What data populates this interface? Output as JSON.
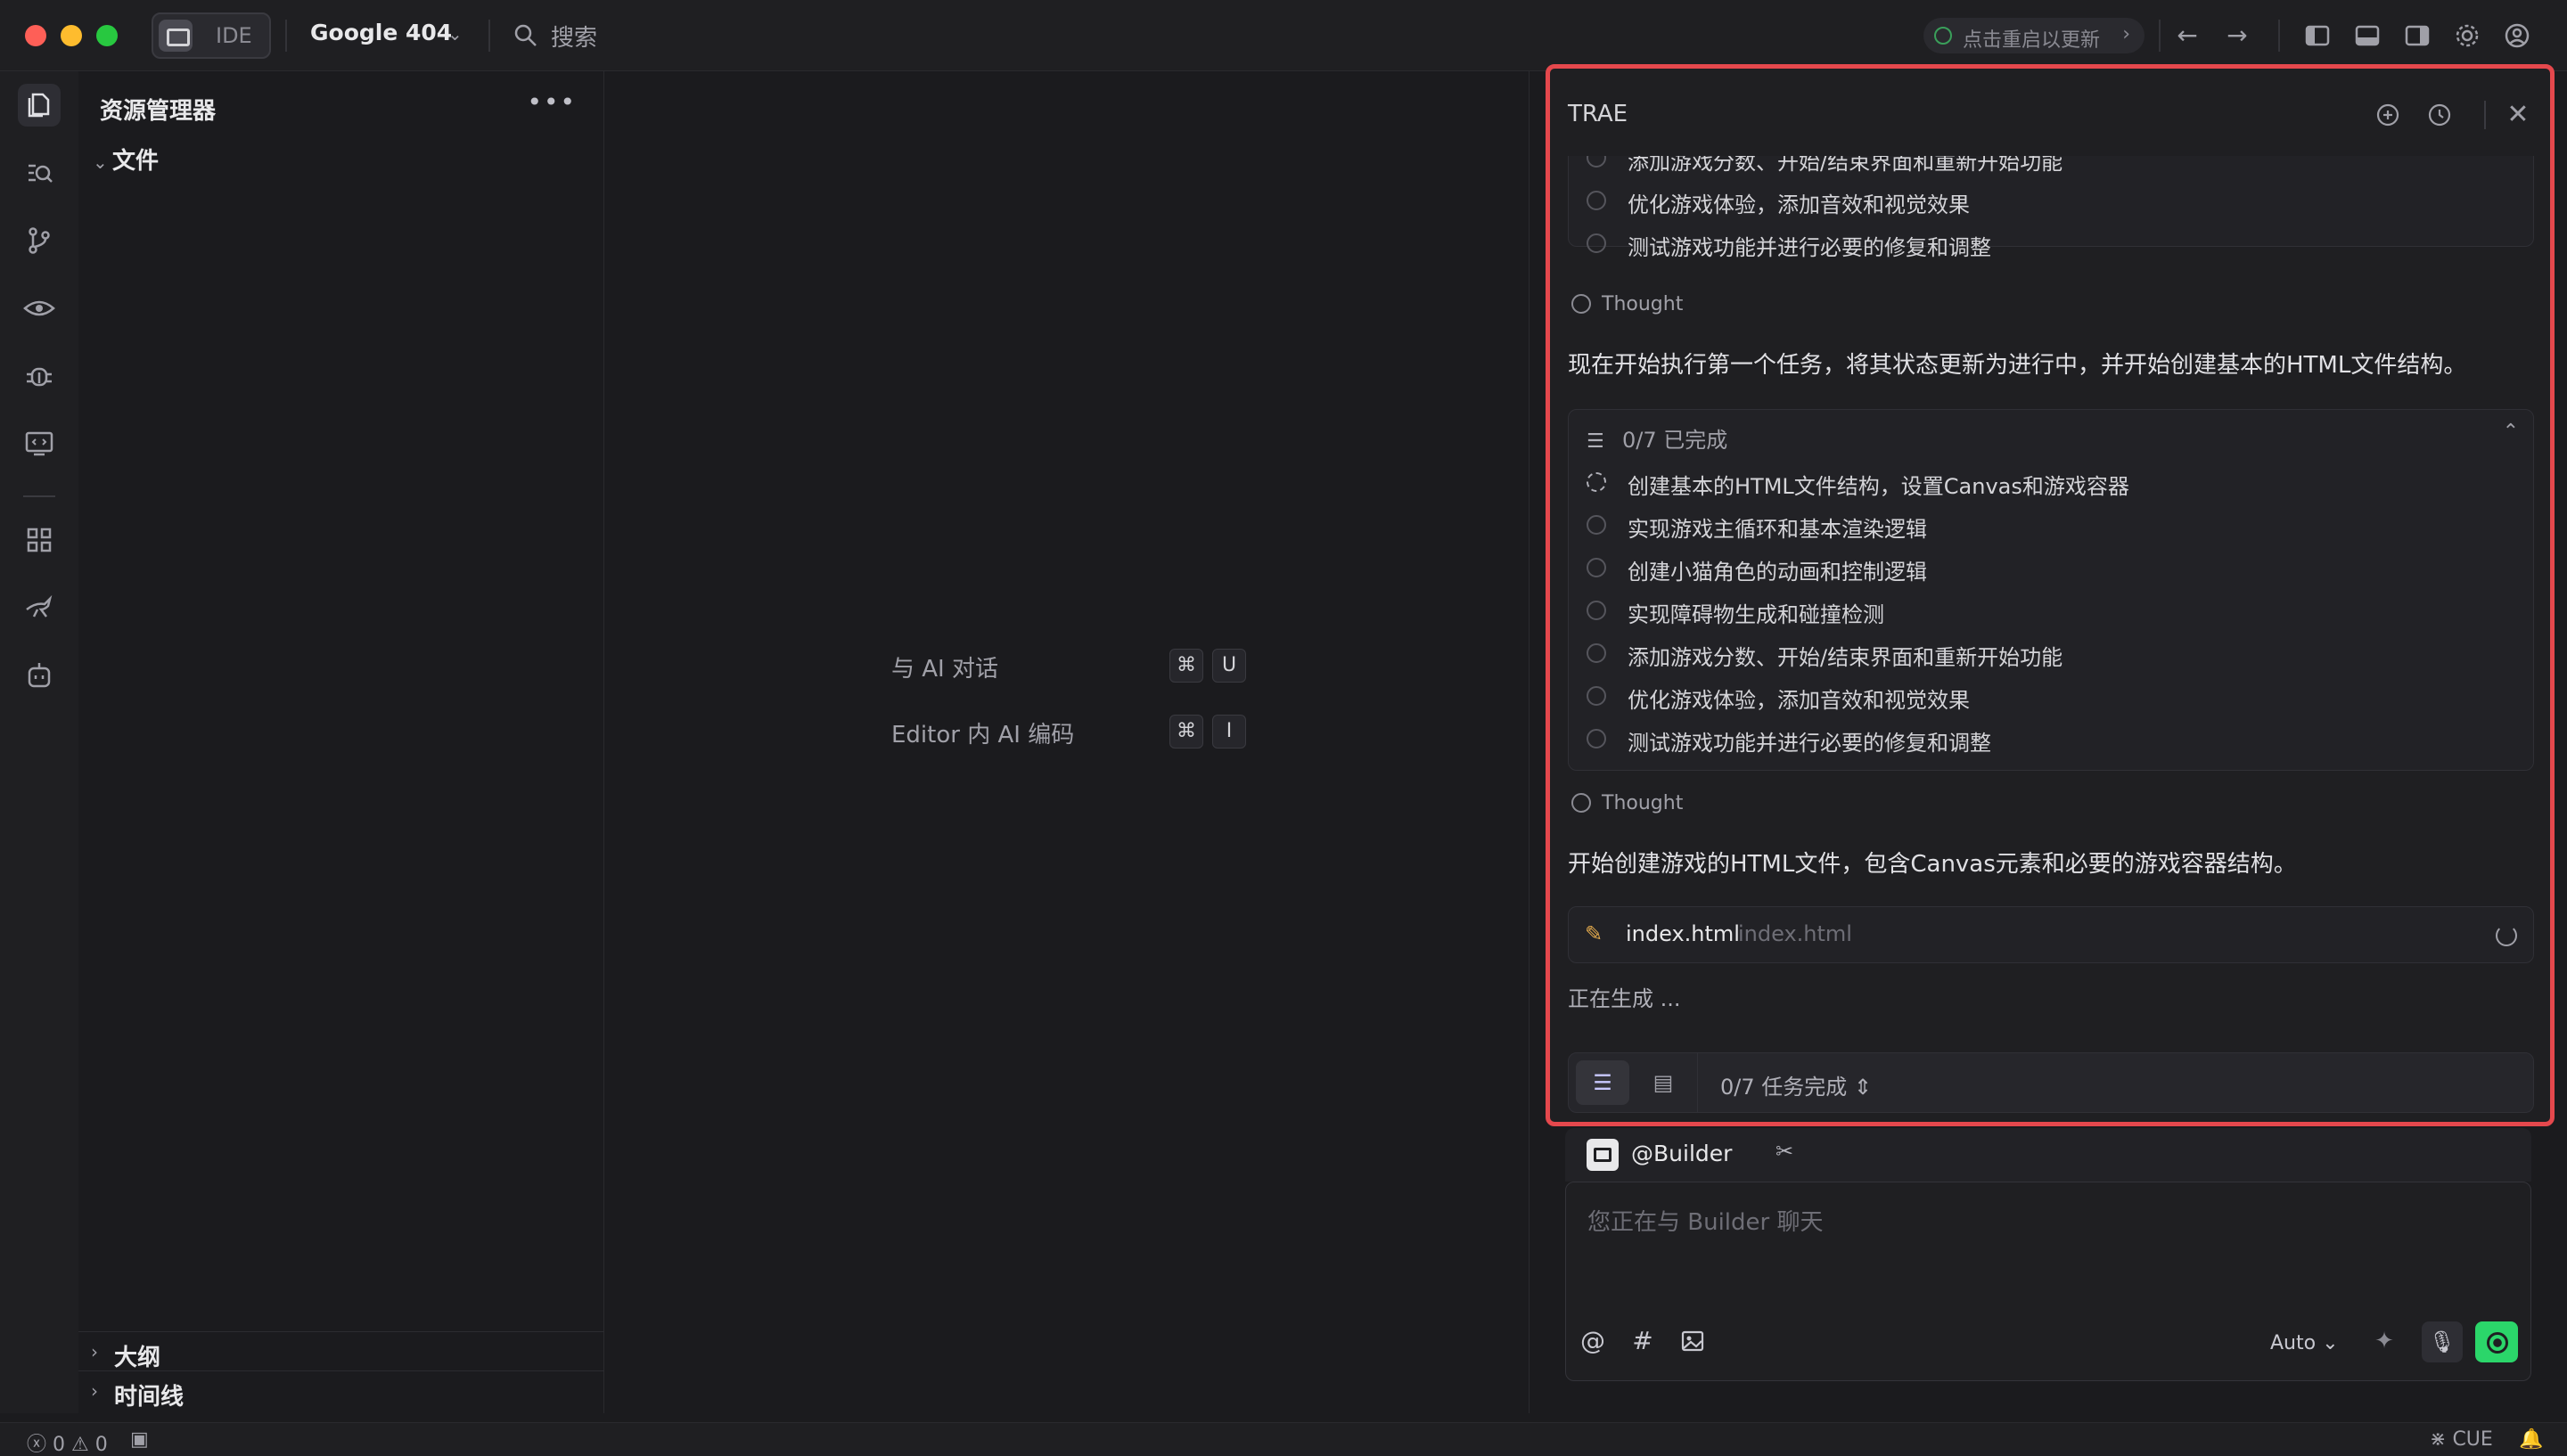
{
  "titlebar": {
    "ide_label": "IDE",
    "project_name": "Google 404",
    "search_label": "搜索",
    "update_label": "点击重启以更新"
  },
  "explorer": {
    "title": "资源管理器",
    "folder": "文件",
    "outline": "大纲",
    "timeline": "时间线"
  },
  "editor": {
    "hint1_label": "与 AI 对话",
    "hint1_keys": [
      "⌘",
      "U"
    ],
    "hint2_label": "Editor 内 AI 编码",
    "hint2_keys": [
      "⌘",
      "I"
    ]
  },
  "panel": {
    "title": "TRAE",
    "top_tasks": [
      "添加游戏分数、开始/结束界面和重新开始功能",
      "优化游戏体验，添加音效和视觉效果",
      "测试游戏功能并进行必要的修复和调整"
    ],
    "thought1_label": "Thought",
    "thought1_text": "现在开始执行第一个任务，将其状态更新为进行中，并开始创建基本的HTML文件结构。",
    "task_card_header": "0/7 已完成",
    "tasks": [
      "创建基本的HTML文件结构，设置Canvas和游戏容器",
      "实现游戏主循环和基本渲染逻辑",
      "创建小猫角色的动画和控制逻辑",
      "实现障碍物生成和碰撞检测",
      "添加游戏分数、开始/结束界面和重新开始功能",
      "优化游戏体验，添加音效和视觉效果",
      "测试游戏功能并进行必要的修复和调整"
    ],
    "thought2_label": "Thought",
    "thought2_text": "开始创建游戏的HTML文件，包含Canvas元素和必要的游戏容器结构。",
    "file_name": "index.html",
    "file_path": "index.html",
    "generating": "正在生成 ...",
    "task_status": "0/7 任务完成"
  },
  "chat": {
    "agent": "@Builder",
    "placeholder": "您正在与 Builder 聊天",
    "model": "Auto"
  },
  "statusbar": {
    "errors": "0",
    "warnings": "0",
    "lang": "CUE"
  },
  "colors": {
    "highlight_border": "#e5484d",
    "send_button": "#2bd66a"
  }
}
